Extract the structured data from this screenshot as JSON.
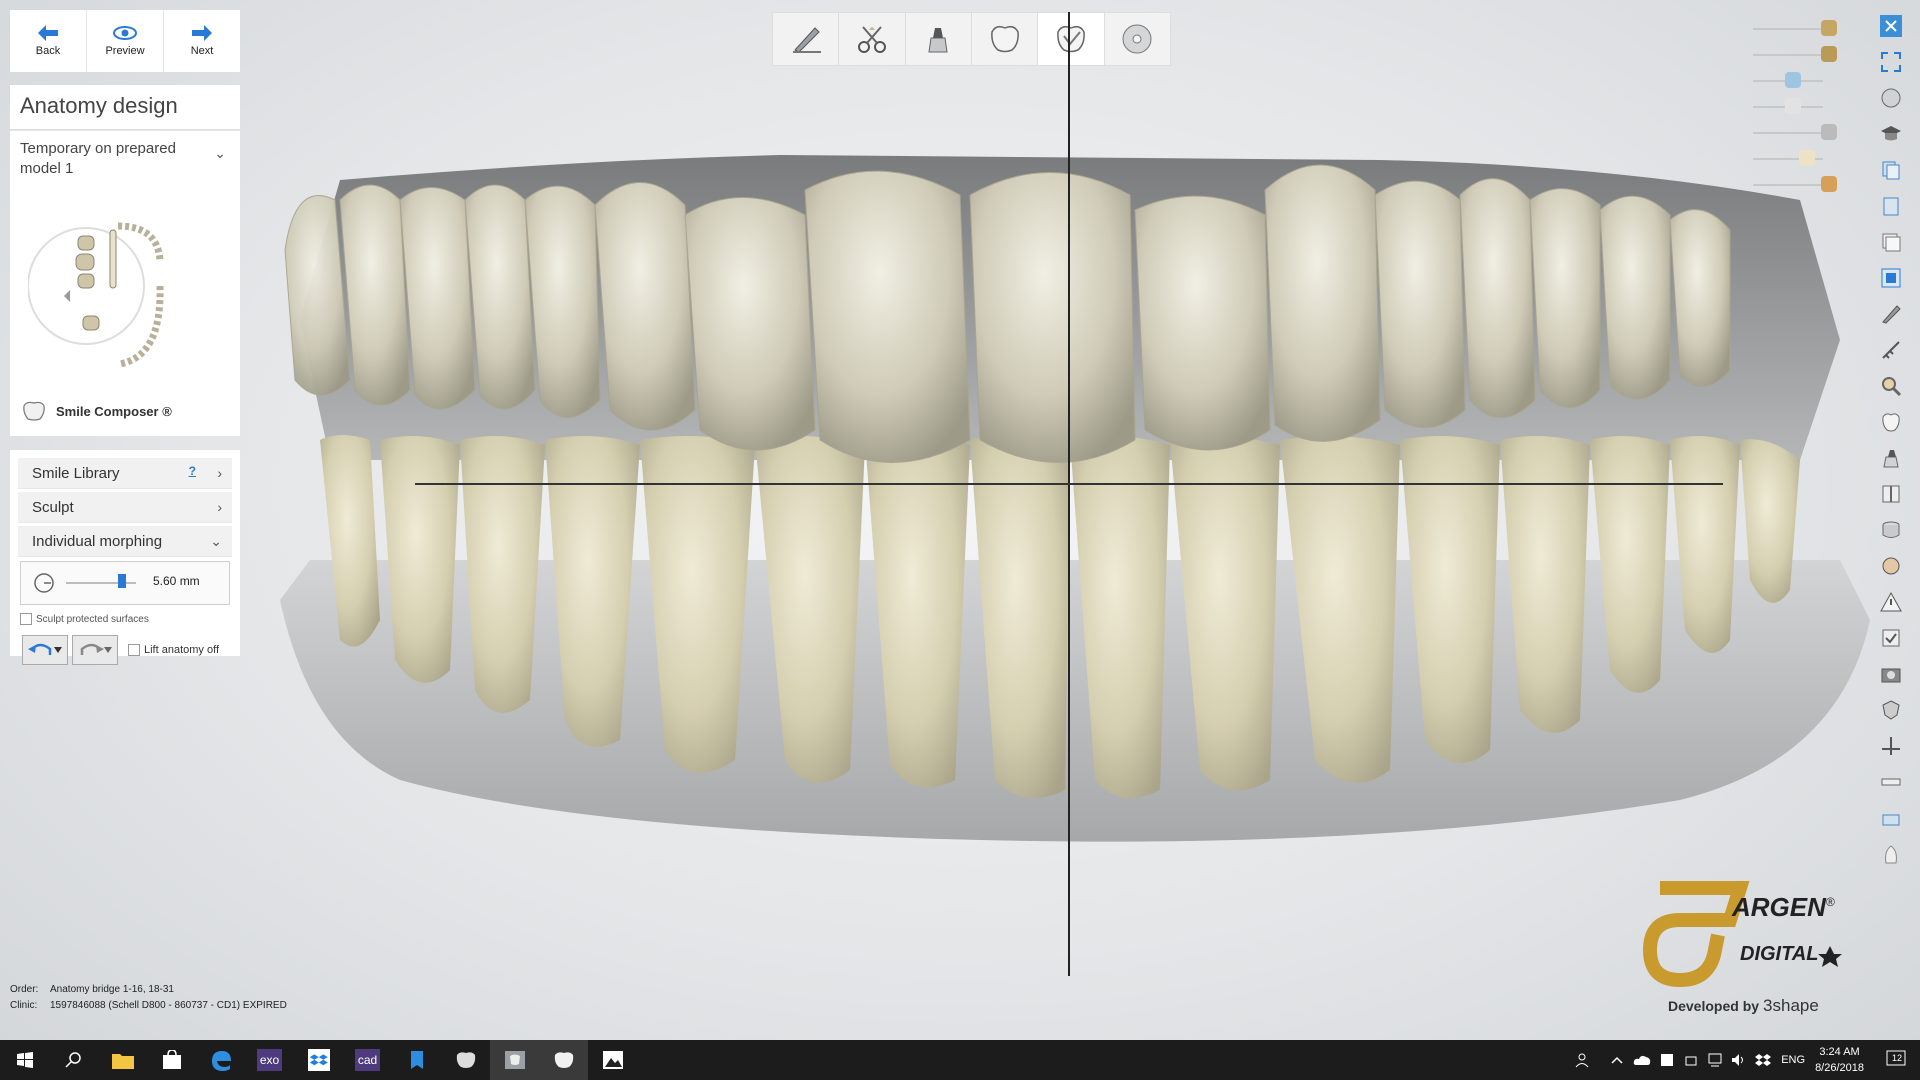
{
  "nav": {
    "back": "Back",
    "preview": "Preview",
    "next": "Next"
  },
  "panel": {
    "title": "Anatomy design",
    "case_select": "Temporary on prepared model 1",
    "smile_composer": "Smile Composer ®",
    "tools": {
      "smile_library": "Smile Library",
      "help": "?",
      "sculpt": "Sculpt",
      "individual_morphing": "Individual morphing"
    },
    "slider_value": "5.60 mm",
    "slider_fraction": 0.8,
    "sculpt_protected": "Sculpt protected surfaces",
    "lift_anatomy": "Lift anatomy off"
  },
  "toolbar": [
    "pen-icon",
    "scissors-icon",
    "die-icon",
    "tooth-icon",
    "tooth-check-icon",
    "disc-icon"
  ],
  "toolbar_active_index": 4,
  "order_info": {
    "order_label": "Order:",
    "order_value": "Anatomy bridge 1-16, 18-31",
    "clinic_label": "Clinic:",
    "clinic_value": "1597846088 (Schell D800 - 860737 - CD1) EXPIRED"
  },
  "brand": {
    "name": "ARGEN",
    "reg": "®",
    "sub": "DIGITAL",
    "developed_by": "Developed by",
    "developer": "3shape"
  },
  "taskbar": {
    "apps": [
      "windows-icon",
      "search-icon",
      "file-explorer-icon",
      "store-icon",
      "edge-icon",
      "exo-icon",
      "dropbox-icon",
      "cad-icon",
      "app-icon",
      "tooth-app-icon",
      "tooth-app2-icon",
      "tooth-app3-icon",
      "photos-icon"
    ],
    "exo_label": "exo",
    "cad_label": "cad",
    "lang": "ENG",
    "time": "3:24 AM",
    "date": "8/26/2018",
    "notifications": "12"
  },
  "colors": {
    "accent": "#2a7ad5",
    "brand_gold": "#c99a2e",
    "taskbar": "#1c1c1c"
  }
}
